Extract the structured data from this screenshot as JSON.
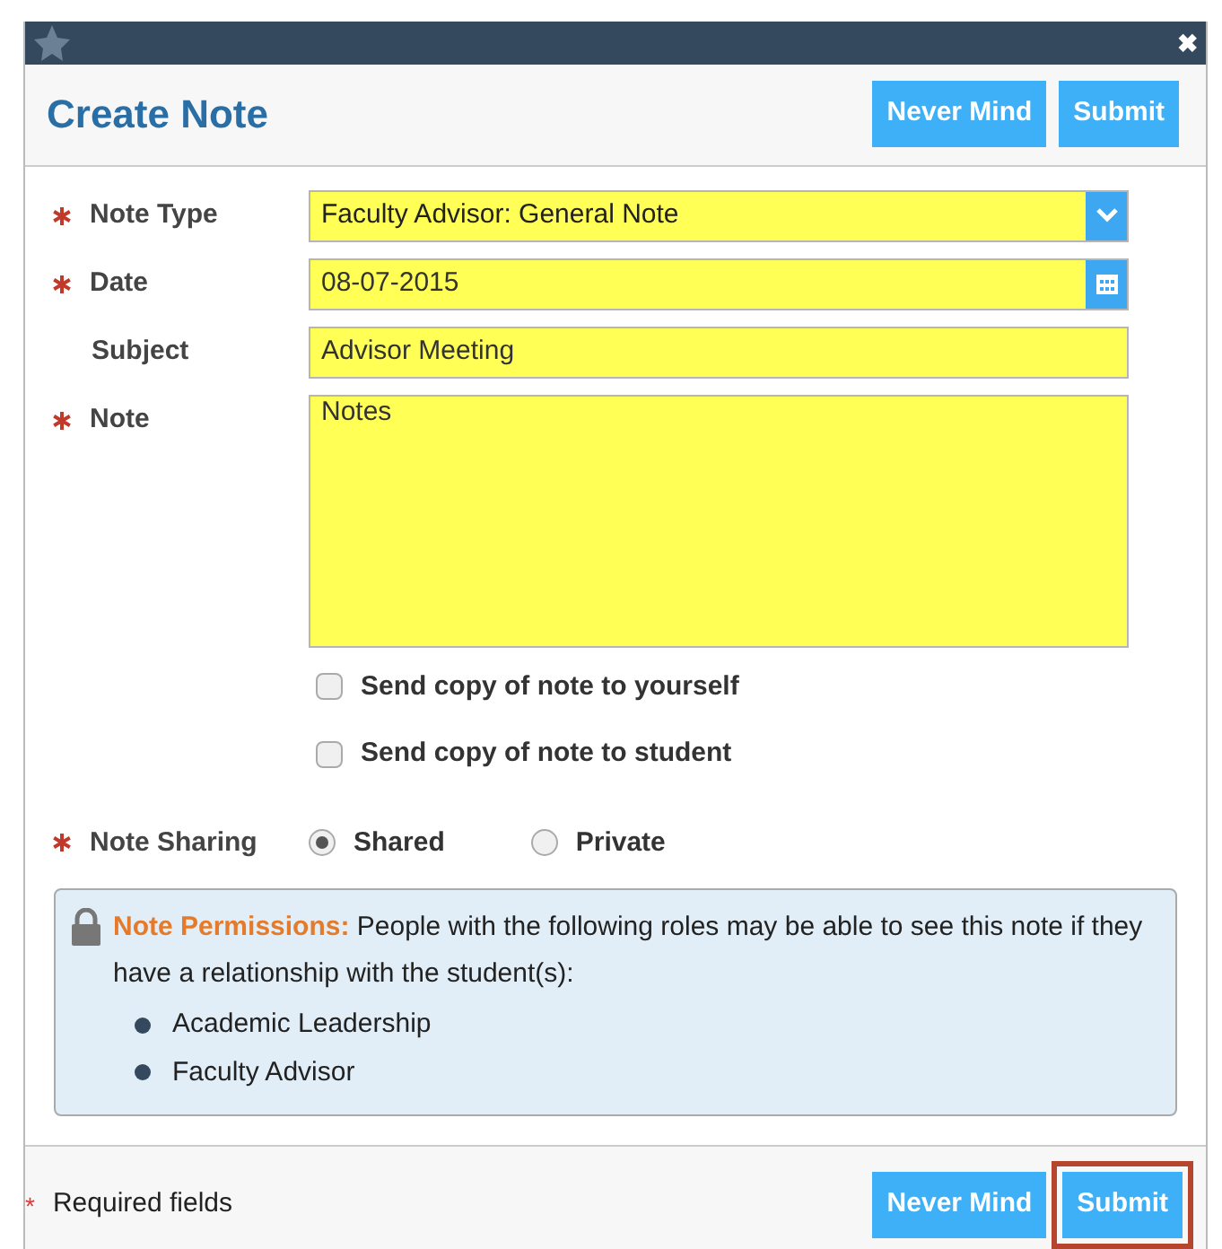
{
  "dialog": {
    "title": "Create Note",
    "header_buttons": [
      "Never Mind",
      "Submit"
    ],
    "close": "✖"
  },
  "fields": [
    {
      "kind": "select",
      "label": "Note Type",
      "required": true,
      "value": "Faculty Advisor: General Note"
    },
    {
      "kind": "date",
      "label": "Date",
      "required": true,
      "value": "08-07-2015"
    },
    {
      "kind": "text",
      "label": "Subject",
      "required": false,
      "value": "Advisor Meeting"
    },
    {
      "kind": "textarea",
      "label": "Note",
      "required": true,
      "value": "Notes"
    }
  ],
  "checkboxes": [
    {
      "label": "Send copy of note to yourself",
      "checked": false
    },
    {
      "label": "Send copy of note to student",
      "checked": false
    }
  ],
  "sharing": {
    "label": "Note Sharing",
    "required": true,
    "options": [
      {
        "label": "Shared",
        "selected": true
      },
      {
        "label": "Private",
        "selected": false
      }
    ]
  },
  "permissions": {
    "title": "Note Permissions:",
    "text": "People with the following roles may be able to see this note if they have a relationship with the student(s):",
    "roles": [
      "Academic Leadership",
      "Faculty Advisor"
    ]
  },
  "footer": {
    "required_mark": "*",
    "required_text": "Required fields",
    "buttons": [
      {
        "label": "Never Mind",
        "highlighted": false
      },
      {
        "label": "Submit",
        "highlighted": true
      }
    ]
  }
}
